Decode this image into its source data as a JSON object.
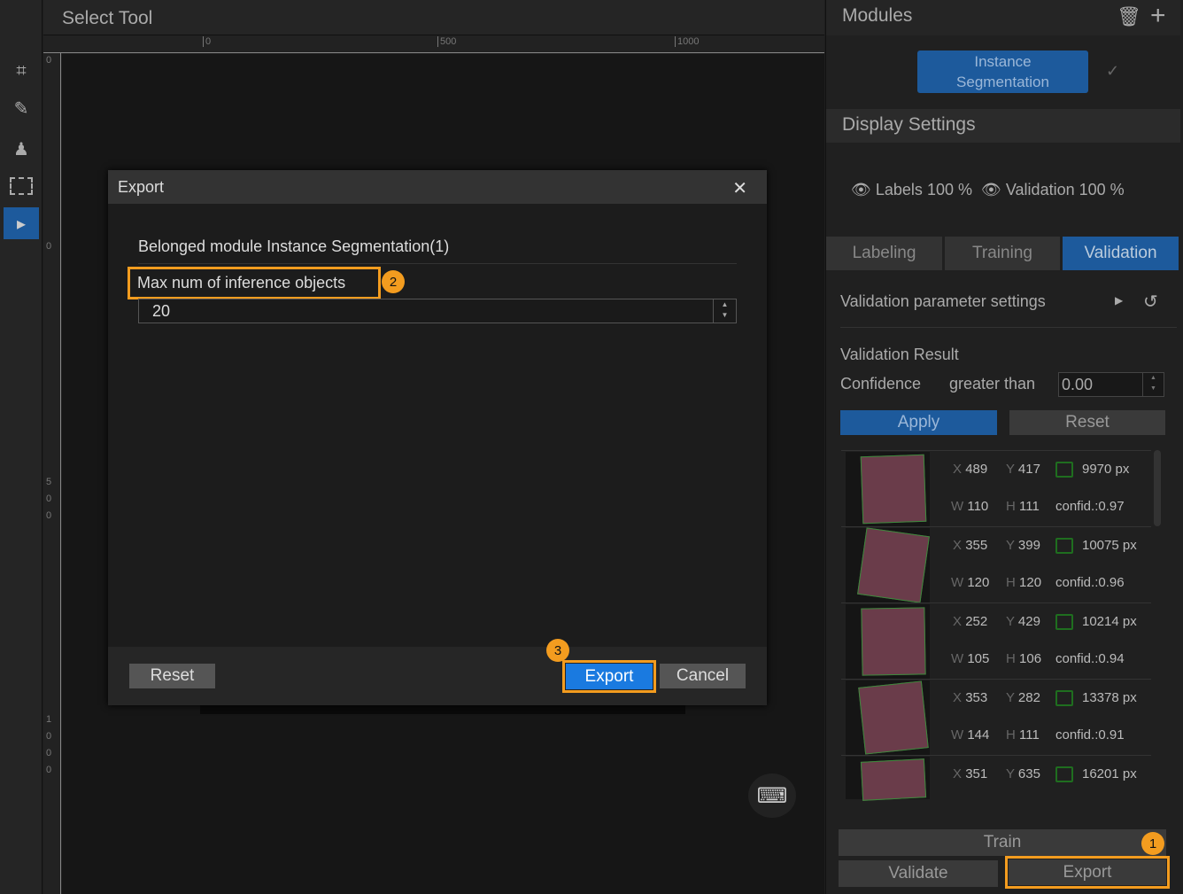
{
  "toolbar": {
    "title": "Select Tool",
    "tools": [
      "polygon-tool",
      "smart-tool",
      "stamp-tool",
      "rect-select-tool",
      "select-tool"
    ]
  },
  "ruler": {
    "top": [
      "0",
      "500",
      "1000"
    ],
    "left": [
      "0",
      "0",
      "5",
      "0",
      "0",
      "1",
      "0",
      "0",
      "0"
    ]
  },
  "dialog": {
    "title": "Export",
    "module_label": "Belonged module Instance Segmentation(1)",
    "max_label": "Max num of inference objects",
    "max_value": "20",
    "reset": "Reset",
    "export": "Export",
    "cancel": "Cancel",
    "badges": [
      "2",
      "3"
    ]
  },
  "panel": {
    "modules_title": "Modules",
    "module_node": "Instance\nSegmentation",
    "display_title": "Display Settings",
    "labels": "Labels",
    "labels_pct": "100 %",
    "validation": "Validation",
    "validation_pct": "100 %",
    "tabs": [
      "Labeling",
      "Training",
      "Validation"
    ],
    "active_tab": "Validation",
    "param_settings": "Validation parameter settings",
    "result_title": "Validation Result",
    "confidence": "Confidence",
    "greater_than": "greater than",
    "conf_value": "0.00",
    "apply": "Apply",
    "reset": "Reset",
    "results": [
      {
        "x": "489",
        "y": "417",
        "area": "9970 px",
        "w": "110",
        "h": "111",
        "conf": "confid.:0.97"
      },
      {
        "x": "355",
        "y": "399",
        "area": "10075 px",
        "w": "120",
        "h": "120",
        "conf": "confid.:0.96"
      },
      {
        "x": "252",
        "y": "429",
        "area": "10214 px",
        "w": "105",
        "h": "106",
        "conf": "confid.:0.94"
      },
      {
        "x": "353",
        "y": "282",
        "area": "13378 px",
        "w": "144",
        "h": "111",
        "conf": "confid.:0.91"
      },
      {
        "x": "351",
        "y": "635",
        "area": "16201 px",
        "w": "",
        "h": "",
        "conf": ""
      }
    ],
    "train": "Train",
    "validate": "Validate",
    "export": "Export",
    "badge": "1"
  },
  "colors": {
    "accent": "#1d5a9c",
    "highlight": "#f39c1f",
    "button_blue": "#1a7ae0"
  }
}
